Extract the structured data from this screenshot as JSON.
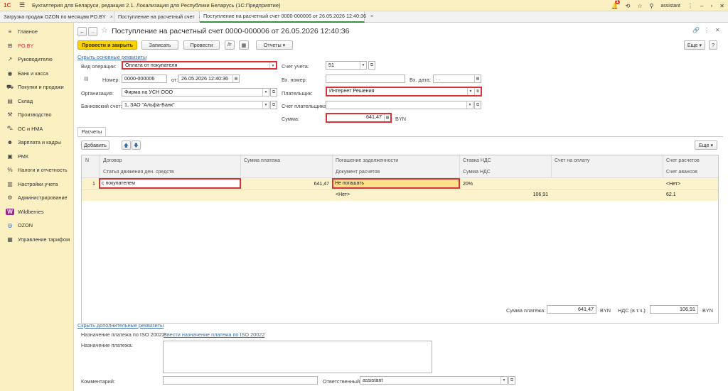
{
  "titlebar": {
    "logo": "1С",
    "app_title": "Бухгалтерия для Беларуси, редакция 2.1. Локализация для Республики Беларусь   (1С:Предприятие)",
    "badge": "1",
    "user": "assistant"
  },
  "tabs": [
    {
      "label": "Загрузка продаж OZON по месяцам РО.BY"
    },
    {
      "label": "Поступление на расчетный счет"
    },
    {
      "label": "Поступление на расчетный счет 0000-000006 от 26.05.2026 12:40:36"
    }
  ],
  "sidebar": {
    "items": [
      {
        "label": "Главное",
        "icon": "≡"
      },
      {
        "label": "PO.BY",
        "icon": "⊞"
      },
      {
        "label": "Руководителю",
        "icon": "↗"
      },
      {
        "label": "Банк и касса",
        "icon": "◉"
      },
      {
        "label": "Покупки и продажи",
        "icon": "⛟"
      },
      {
        "label": "Склад",
        "icon": "▤"
      },
      {
        "label": "Производство",
        "icon": "⚒"
      },
      {
        "label": "ОС и НМА",
        "icon": "⛍"
      },
      {
        "label": "Зарплата и кадры",
        "icon": "☻"
      },
      {
        "label": "РМК",
        "icon": "▣"
      },
      {
        "label": "Налоги и отчетность",
        "icon": "%"
      },
      {
        "label": "Настройки учета",
        "icon": "▥"
      },
      {
        "label": "Администрирование",
        "icon": "⚙"
      },
      {
        "label": "Wildberries",
        "icon": "W"
      },
      {
        "label": "OZON",
        "icon": "◎"
      },
      {
        "label": "Управление тарифом",
        "icon": "▦"
      }
    ]
  },
  "doc": {
    "title": "Поступление на расчетный счет 0000-000006 от 26.05.2026 12:40:36",
    "toolbar": {
      "post_close": "Провести и закрыть",
      "save": "Записать",
      "post": "Провести",
      "reports": "Отчеты",
      "more": "Еще"
    },
    "hide_main": "Скрыть основные реквизиты",
    "op_type_label": "Вид операции:",
    "op_type": "Оплата от покупателя",
    "account_label": "Счет учета:",
    "account": "51",
    "number_label": "Номер:",
    "number": "0000-000006",
    "date_label": "от:",
    "date": "26.05.2026 12:40:36",
    "in_number_label": "Вх. номер:",
    "in_number": "",
    "in_date_label": "Вх. дата:",
    "in_date": " .  .",
    "org_label": "Организация:",
    "org": "Фирма на УСН ООО",
    "payer_label": "Плательщик:",
    "payer": "Интернет Решения",
    "bank_label": "Банковский счет:",
    "bank": "1, ЗАО \"Альфа-Банк\"",
    "payer_account_label": "Счет плательщика:",
    "payer_account": "",
    "sum_label": "Сумма:",
    "sum": "641,47",
    "currency": "BYN"
  },
  "payments": {
    "tab": "Расчеты",
    "add": "Добавить",
    "more": "Еще",
    "columns": {
      "n": "N",
      "contract": "Договор",
      "cashflow": "Статья движения ден. средств",
      "amount": "Сумма платежа",
      "repayment": "Погашение задолженности",
      "settlement_doc": "Документ расчетов",
      "vat_rate": "Ставка НДС",
      "vat_amount": "Сумма НДС",
      "invoice": "Счет на оплату",
      "settle_account": "Счет расчетов",
      "advance_account": "Счет авансов"
    },
    "rows": [
      {
        "n": "1",
        "contract": "с покупателем",
        "cashflow": "",
        "amount": "641,47",
        "repayment": "Не погашать",
        "settlement_doc": "<Нет>",
        "vat_rate": "20%",
        "vat_amount": "106,91",
        "invoice": "",
        "settle_account": "<Нет>",
        "advance_account": "62.1"
      }
    ]
  },
  "totals": {
    "sum_label": "Сумма платежа:",
    "sum": "641,47",
    "vat_label": "НДС (в т.ч.):",
    "vat": "106,91",
    "currency": "BYN"
  },
  "extra": {
    "hide_extra": "Скрыть дополнительные реквизиты",
    "iso_label": "Назначение платежа по ISO 20022:",
    "iso_link": "Ввести назначение платежа по ISO 20022",
    "purpose_label": "Назначение платежа:",
    "comment_label": "Комментарий:",
    "responsible_label": "Ответственный:",
    "responsible": "assistant"
  }
}
